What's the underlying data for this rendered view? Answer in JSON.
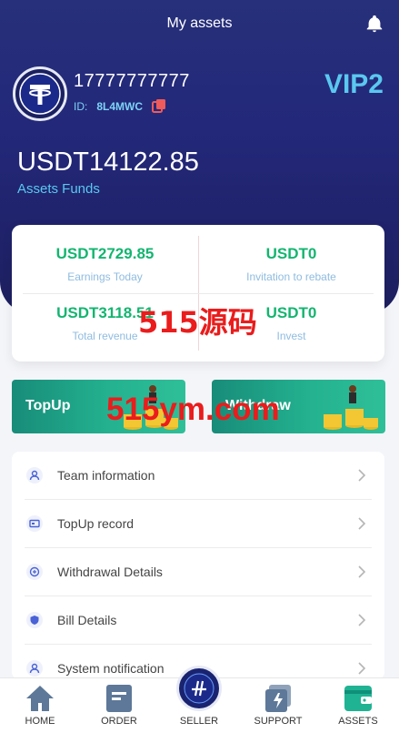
{
  "header": {
    "title": "My assets",
    "icon": "bell-icon"
  },
  "profile": {
    "phone": "17777777777",
    "id_label": "ID:",
    "id_value": "8L4MWC",
    "vip": "VIP2"
  },
  "assets": {
    "amount": "USDT14122.85",
    "label": "Assets Funds"
  },
  "stats": [
    {
      "value": "USDT2729.85",
      "label": "Earnings Today"
    },
    {
      "value": "USDT0",
      "label": "Invitation to rebate"
    },
    {
      "value": "USDT3118.51",
      "label": "Total revenue"
    },
    {
      "value": "USDT0",
      "label": "Invest"
    }
  ],
  "actions": {
    "topup": "TopUp",
    "withdraw": "Withdraw"
  },
  "menu": [
    {
      "label": "Team information",
      "icon": "team-icon"
    },
    {
      "label": "TopUp record",
      "icon": "card-icon"
    },
    {
      "label": "Withdrawal Details",
      "icon": "withdraw-icon"
    },
    {
      "label": "Bill Details",
      "icon": "shield-icon"
    },
    {
      "label": "System notification",
      "icon": "user-icon"
    }
  ],
  "watermarks": [
    "515源码",
    "515ym.com"
  ],
  "tabs": [
    {
      "label": "HOME",
      "icon": "home-icon"
    },
    {
      "label": "ORDER",
      "icon": "order-icon"
    },
    {
      "label": "SELLER",
      "icon": "seller-icon"
    },
    {
      "label": "SUPPORT",
      "icon": "support-icon"
    },
    {
      "label": "ASSETS",
      "icon": "wallet-icon"
    }
  ],
  "colors": {
    "header_bg": "#23287a",
    "accent_green": "#13b570",
    "accent_cyan": "#5ac8f0",
    "button_green": "#23b18f"
  }
}
